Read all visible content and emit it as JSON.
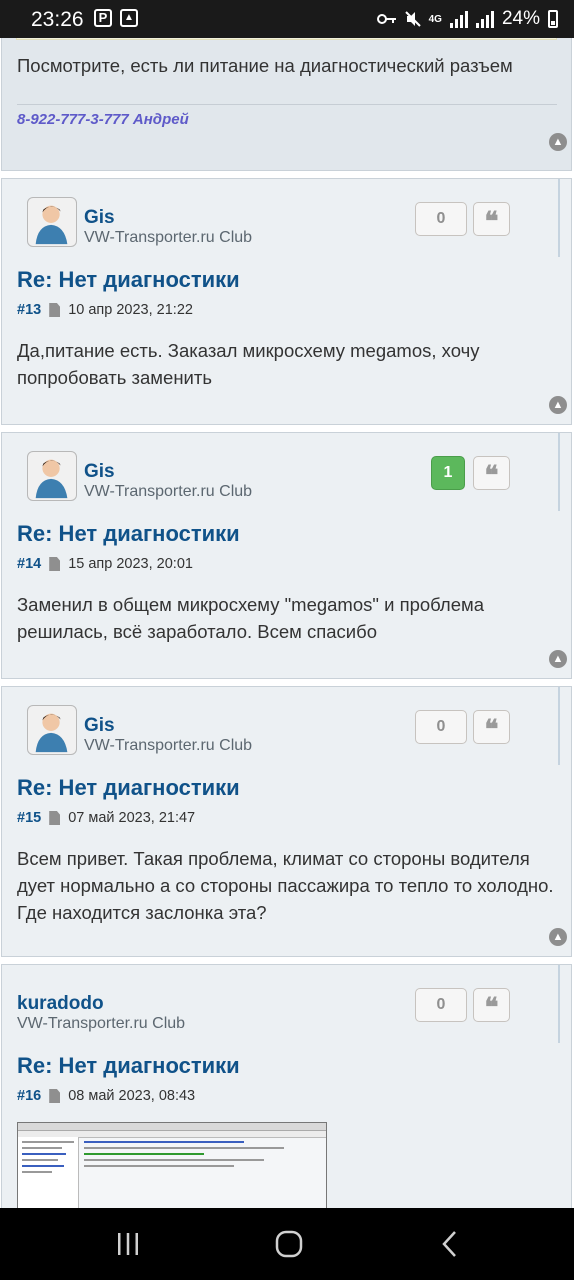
{
  "status_bar": {
    "time": "23:26",
    "network": "4G",
    "battery": "24%"
  },
  "posts": {
    "p0": {
      "text": "Посмотрите, есть ли питание на диагностический разъем",
      "signature": "8-922-777-3-777 Андрей"
    },
    "p13": {
      "author": "Gis",
      "club": "VW-Transporter.ru Club",
      "score": "0",
      "title": "Re: Нет диагностики",
      "number": "#13",
      "date": "10 апр 2023, 21:22",
      "text": "Да,питание есть. Заказал микросхему megamos, хочу попробовать заменить"
    },
    "p14": {
      "author": "Gis",
      "club": "VW-Transporter.ru Club",
      "score": "1",
      "title": "Re: Нет диагностики",
      "number": "#14",
      "date": "15 апр 2023, 20:01",
      "text": "Заменил в общем микросхему \"megamos\" и проблема решилась, всё заработало. Всем спасибо"
    },
    "p15": {
      "author": "Gis",
      "club": "VW-Transporter.ru Club",
      "score": "0",
      "title": "Re: Нет диагностики",
      "number": "#15",
      "date": "07 май 2023, 21:47",
      "text": "Всем привет. Такая проблема, климат со стороны водителя дует нормально а со стороны пассажира то тепло то холодно. Где находится заслонка эта?"
    },
    "p16": {
      "author": "kuradodo",
      "club": "VW-Transporter.ru Club",
      "score": "0",
      "title": "Re: Нет диагностики",
      "number": "#16",
      "date": "08 май 2023, 08:43"
    }
  },
  "icons": {
    "quote": "❝",
    "up": "▲"
  },
  "colors": {
    "link": "#105289",
    "signature": "#5e5ac9",
    "positive": "#5cb85c"
  }
}
